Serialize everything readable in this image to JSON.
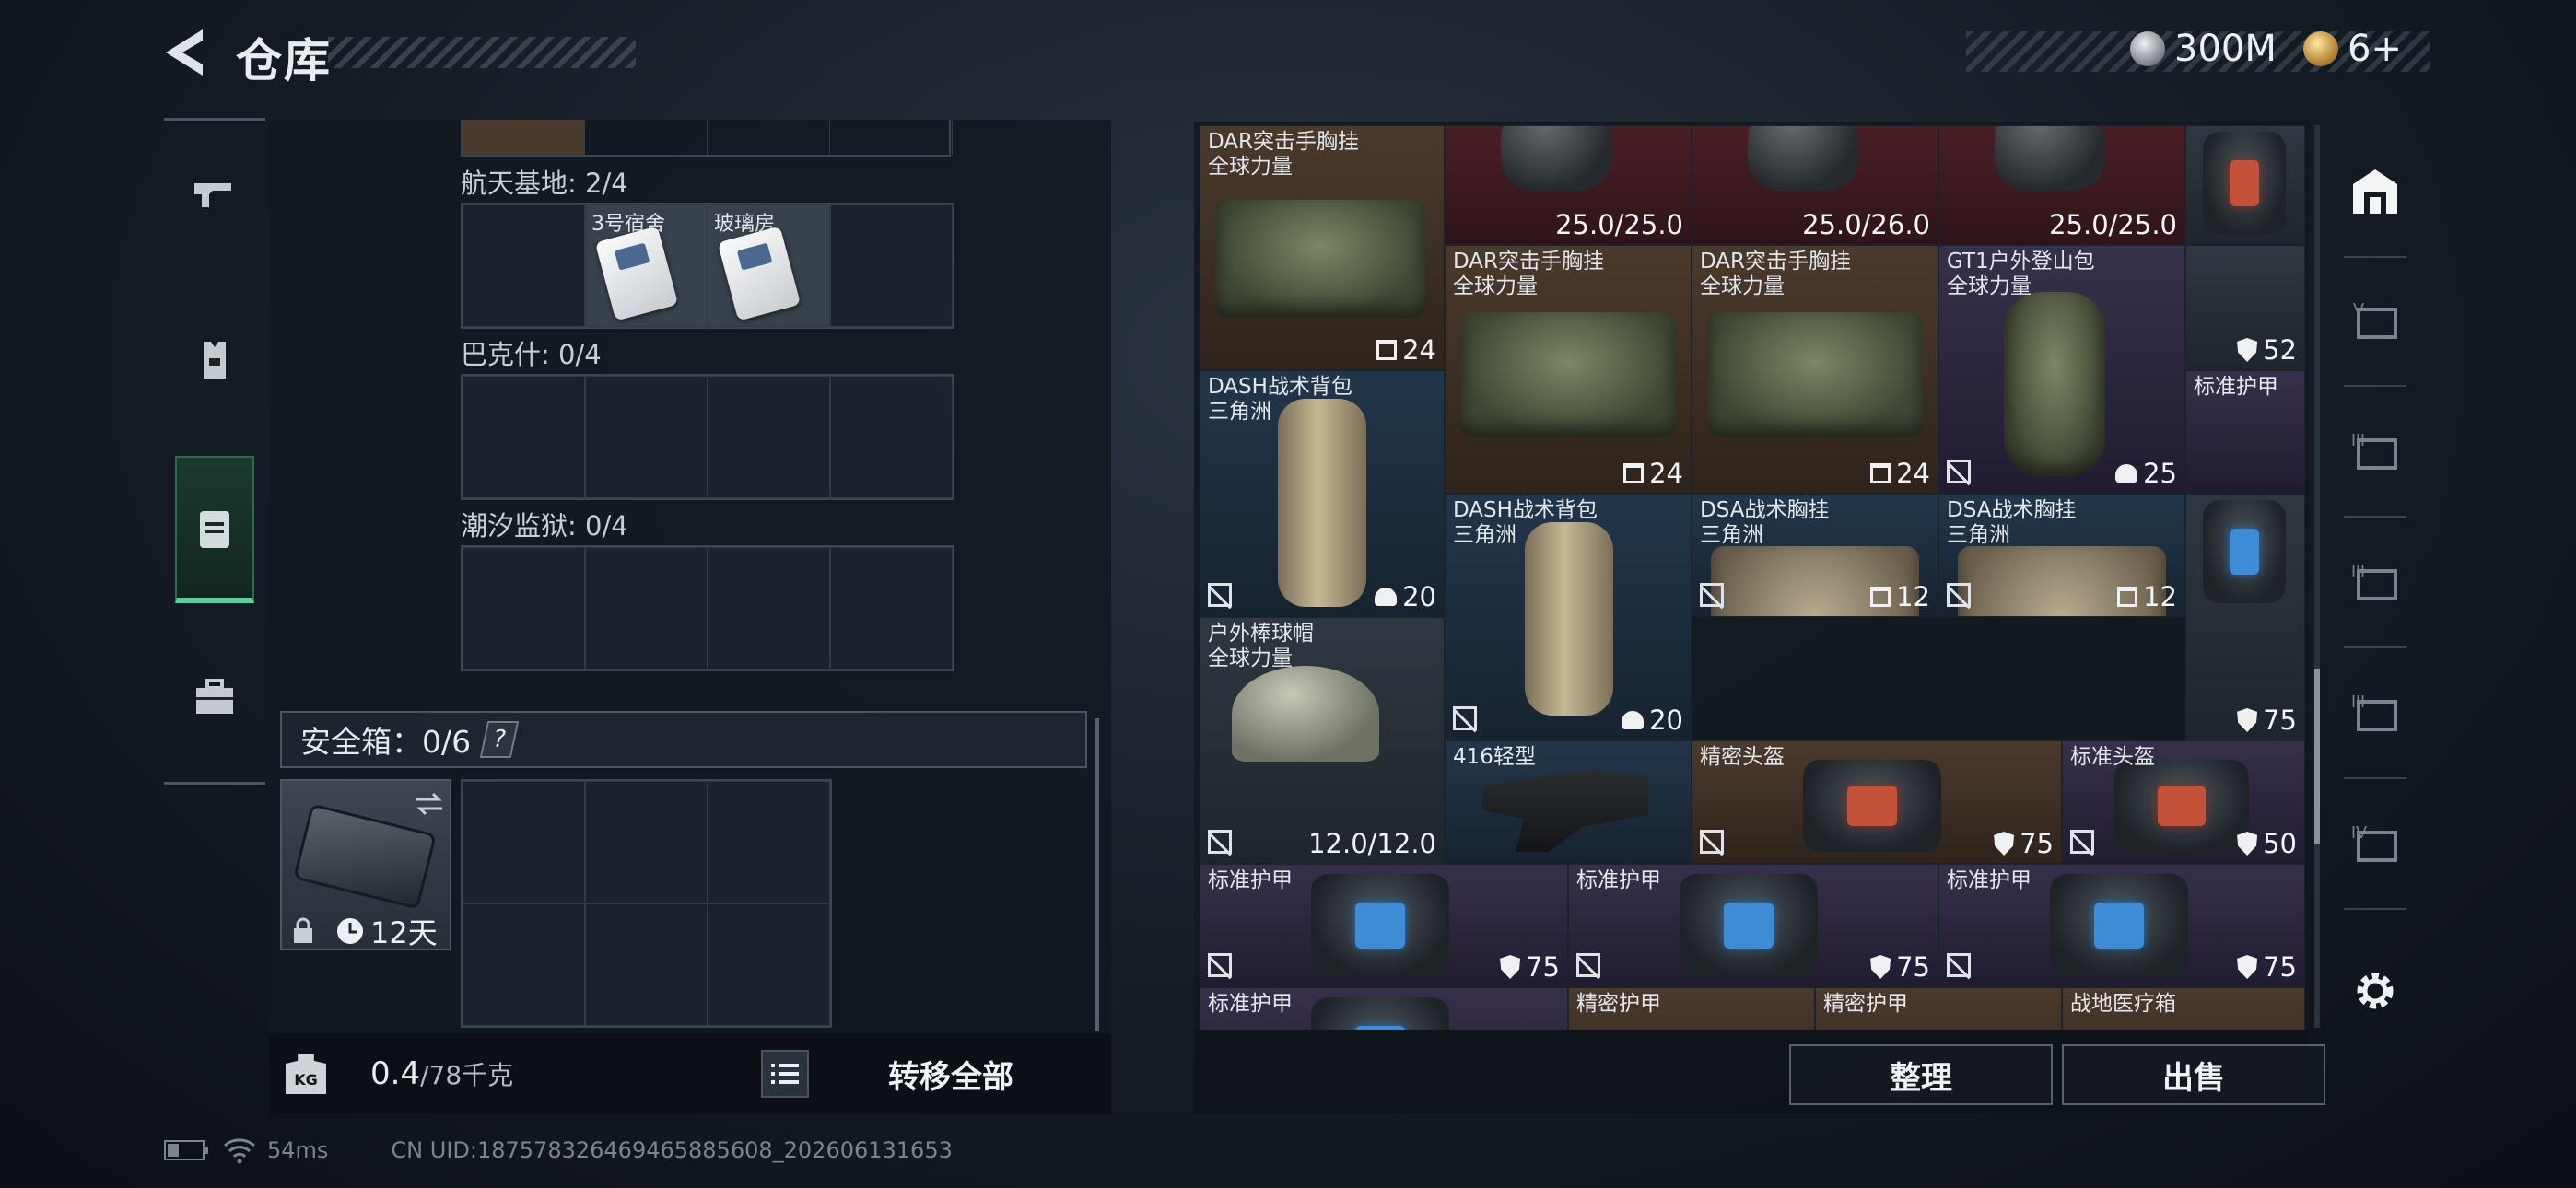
{
  "header": {
    "title": "仓库"
  },
  "currency": {
    "silver": "300M",
    "gold": "6+"
  },
  "containers": {
    "groups": [
      {
        "label": "航天基地: 2/4"
      },
      {
        "label": "巴克什: 0/4"
      },
      {
        "label": "潮汐监狱: 0/4"
      }
    ],
    "keycards": [
      "3号宿舍",
      "玻璃房"
    ],
    "safebox": {
      "label": "安全箱：0/6",
      "help": "?",
      "duration": "12天"
    }
  },
  "weight": {
    "current": "0.4",
    "max": "/78千克"
  },
  "buttons": {
    "transfer_all": "转移全部",
    "organize": "整理",
    "sell": "出售"
  },
  "items": [
    {
      "name": "DAR突击手胸挂\n全球力量",
      "value": "24"
    },
    {
      "name": "",
      "value": "25.0/25.0"
    },
    {
      "name": "",
      "value": "25.0/26.0"
    },
    {
      "name": "",
      "value": "25.0/25.0"
    },
    {
      "name": "DAR突击手胸挂\n全球力量",
      "value": "24"
    },
    {
      "name": "DAR突击手胸挂\n全球力量",
      "value": "24"
    },
    {
      "name": "GT1户外登山包\n全球力量",
      "value": "25"
    },
    {
      "name": "",
      "value": "52"
    },
    {
      "name": "标准护甲",
      "value": ""
    },
    {
      "name": "DASH战术背包\n三角洲",
      "value": "20"
    },
    {
      "name": "DASH战术背包\n三角洲",
      "value": "20"
    },
    {
      "name": "DSA战术胸挂\n三角洲",
      "value": "12"
    },
    {
      "name": "DSA战术胸挂\n三角洲",
      "value": "12"
    },
    {
      "name": "",
      "value": "75"
    },
    {
      "name": "户外棒球帽\n全球力量",
      "value": "12.0/12.0"
    },
    {
      "name": "416轻型",
      "value": ""
    },
    {
      "name": "精密头盔",
      "value": "75"
    },
    {
      "name": "标准头盔",
      "value": "50"
    },
    {
      "name": "标准护甲",
      "value": "75"
    },
    {
      "name": "标准护甲",
      "value": "75"
    },
    {
      "name": "标准护甲",
      "value": "75"
    },
    {
      "name": "标准护甲",
      "value": ""
    },
    {
      "name": "精密护甲",
      "value": ""
    },
    {
      "name": "精密护甲",
      "value": ""
    },
    {
      "name": "战地医疗箱",
      "value": ""
    }
  ],
  "status": {
    "ping": "54ms",
    "uid": "CN UID:1875783264694658856​08_202606131653"
  }
}
